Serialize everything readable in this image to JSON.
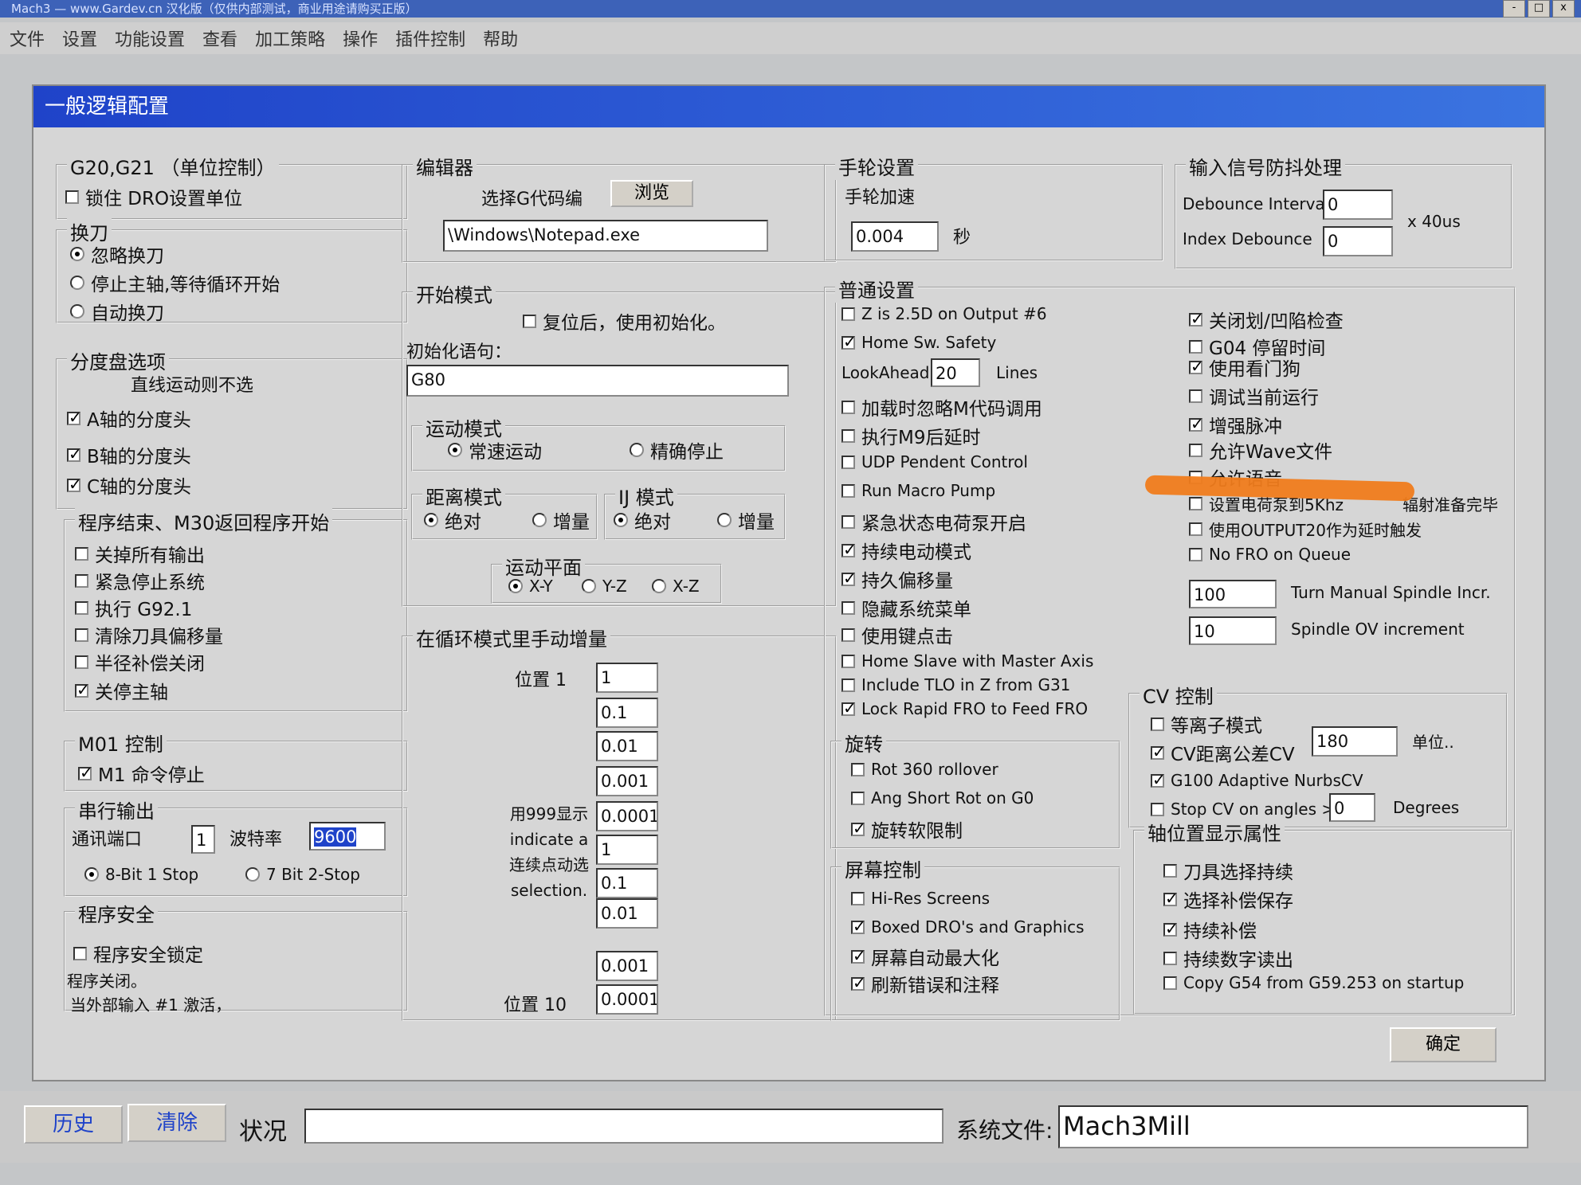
{
  "app": {
    "title": "Mach3 — www.Gardev.cn 汉化版（仅供内部测试，商业用途请购买正版）",
    "window_buttons": [
      "-",
      "□",
      "x"
    ],
    "menu": [
      "文件",
      "设置",
      "功能设置",
      "查看",
      "加工策略",
      "操作",
      "插件控制",
      "帮助"
    ]
  },
  "dialog": {
    "title": "一般逻辑配置",
    "units": {
      "legend": "G20,G21 （单位控制）",
      "lock_dro": {
        "label": "锁住 DRO设置单位",
        "checked": false
      }
    },
    "toolchange": {
      "legend": "换刀",
      "options": [
        {
          "label": "忽略换刀",
          "selected": true
        },
        {
          "label": "停止主轴,等待循环开始",
          "selected": false
        },
        {
          "label": "自动换刀",
          "selected": false
        }
      ]
    },
    "indexer": {
      "legend": "分度盘选项",
      "note": "直线运动则不选",
      "items": [
        {
          "label": "A轴的分度头",
          "checked": true
        },
        {
          "label": "B轴的分度头",
          "checked": true
        },
        {
          "label": "C轴的分度头",
          "checked": true
        }
      ]
    },
    "program_end": {
      "legend": "程序结束、M30返回程序开始",
      "items": [
        {
          "label": "关掉所有输出",
          "checked": false
        },
        {
          "label": "紧急停止系统",
          "checked": false
        },
        {
          "label": "执行 G92.1",
          "checked": false
        },
        {
          "label": "清除刀具偏移量",
          "checked": false
        },
        {
          "label": "半径补偿关闭",
          "checked": false
        },
        {
          "label": "关停主轴",
          "checked": true
        }
      ]
    },
    "m01": {
      "legend": "M01 控制",
      "item": {
        "label": "M1 命令停止",
        "checked": true
      }
    },
    "serial": {
      "legend": "串行输出",
      "port_label": "通讯端口",
      "port_value": "1",
      "baud_label": "波特率",
      "baud_value": "9600",
      "modes": [
        {
          "label": "8-Bit 1 Stop",
          "selected": true
        },
        {
          "label": "7 Bit 2-Stop",
          "selected": false
        }
      ]
    },
    "safety": {
      "legend": "程序安全",
      "item": {
        "label": "程序安全锁定",
        "checked": false
      },
      "note1": "程序关闭。",
      "note2": "当外部输入 #1 激活，"
    },
    "editor": {
      "legend": "编辑器",
      "select_label": "选择G代码编",
      "browse": "浏览",
      "path": "\\Windows\\Notepad.exe"
    },
    "start_mode": {
      "legend": "开始模式",
      "reset_init": {
        "label": "复位后，使用初始化。",
        "checked": false
      },
      "init_label": "初始化语句：",
      "init_value": "G80",
      "motion": {
        "legend": "运动模式",
        "options": [
          {
            "label": "常速运动",
            "selected": true
          },
          {
            "label": "精确停止",
            "selected": false
          }
        ]
      },
      "distance": {
        "legend": "距离模式",
        "options": [
          {
            "label": "绝对",
            "selected": true
          },
          {
            "label": "增量",
            "selected": false
          }
        ]
      },
      "ij": {
        "legend": "IJ 模式",
        "options": [
          {
            "label": "绝对",
            "selected": true
          },
          {
            "label": "增量",
            "selected": false
          }
        ]
      },
      "plane": {
        "legend": "运动平面",
        "options": [
          {
            "label": "X-Y",
            "selected": true
          },
          {
            "label": "Y-Z",
            "selected": false
          },
          {
            "label": "X-Z",
            "selected": false
          }
        ]
      }
    },
    "cycle_jog": {
      "legend": "在循环模式里手动增量",
      "pos1": "位置 1",
      "pos10": "位置 10",
      "note": [
        "用999显示",
        "indicate a",
        "连续点动选",
        "selection."
      ],
      "values": [
        "1",
        "0.1",
        "0.01",
        "0.001",
        "0.0001",
        "1",
        "0.1",
        "0.01",
        "0.001",
        "0.0001"
      ]
    },
    "mpg": {
      "legend": "手轮设置",
      "accel_label": "手轮加速",
      "accel_value": "0.004",
      "unit": "秒"
    },
    "debounce": {
      "legend": "输入信号防抖处理",
      "interval_label": "Debounce Interval",
      "interval_value": "0",
      "index_label": "Index Debounce",
      "index_value": "0",
      "unit": "x 40us"
    },
    "general": {
      "legend": "普通设置",
      "left_a": [
        {
          "label": "Z is 2.5D on Output #6",
          "checked": false
        },
        {
          "label": "Home Sw. Safety",
          "checked": true
        }
      ],
      "lookahead_label": "LookAhead",
      "lookahead_value": "20",
      "lookahead_unit": "Lines",
      "left_b": [
        {
          "label": "加载时忽略M代码调用",
          "checked": false
        },
        {
          "label": "执行M9后延时",
          "checked": false
        },
        {
          "label": "UDP Pendent Control",
          "checked": false
        },
        {
          "label": "Run Macro Pump",
          "checked": false
        },
        {
          "label": "紧急状态电荷泵开启",
          "checked": false
        },
        {
          "label": "持续电动模式",
          "checked": true
        },
        {
          "label": "持久偏移量",
          "checked": true
        },
        {
          "label": "隐藏系统菜单",
          "checked": false
        },
        {
          "label": "使用键点击",
          "checked": false
        },
        {
          "label": "Home Slave with Master Axis",
          "checked": false
        },
        {
          "label": "Include TLO in Z from G31",
          "checked": false
        },
        {
          "label": "Lock Rapid FRO to Feed FRO",
          "checked": true
        }
      ],
      "right": [
        {
          "label": "关闭划/凹陷检查",
          "checked": true
        },
        {
          "label": "G04 停留时间",
          "checked": false
        },
        {
          "label": "使用看门狗",
          "checked": true
        },
        {
          "label": "调试当前运行",
          "checked": false
        },
        {
          "label": "增强脉冲",
          "checked": true
        },
        {
          "label": "允许Wave文件",
          "checked": false
        },
        {
          "label": "允许语音",
          "checked": false
        },
        {
          "label": "设置电荷泵到5Khz",
          "checked": false
        },
        {
          "label": "使用OUTPUT20作为延时触发",
          "checked": false
        },
        {
          "label": "No FRO on Queue",
          "checked": false
        }
      ],
      "extra_note": "辐射准备完毕",
      "spindle_incr_value": "100",
      "spindle_incr_label": "Turn Manual Spindle Incr.",
      "spindle_ov_value": "10",
      "spindle_ov_label": "Spindle OV increment"
    },
    "rotation": {
      "legend": "旋转",
      "items": [
        {
          "label": "Rot 360 rollover",
          "checked": false
        },
        {
          "label": "Ang Short Rot on G0",
          "checked": false
        },
        {
          "label": "旋转软限制",
          "checked": true
        }
      ]
    },
    "screen": {
      "legend": "屏幕控制",
      "items": [
        {
          "label": "Hi-Res Screens",
          "checked": false
        },
        {
          "label": "Boxed DRO's and Graphics",
          "checked": true
        },
        {
          "label": "屏幕自动最大化",
          "checked": true
        },
        {
          "label": "刷新错误和注释",
          "checked": true
        }
      ]
    },
    "cv": {
      "legend": "CV 控制",
      "plasma": {
        "label": "等离子模式",
        "checked": false
      },
      "cv_dist": {
        "label": "CV距离公差CV",
        "checked": true
      },
      "cv_value": "180",
      "cv_unit": "单位..",
      "g100": {
        "label": "G100 Adaptive NurbsCV",
        "checked": true
      },
      "stop_angles": {
        "label": "Stop CV on angles >",
        "checked": false
      },
      "angle_value": "0",
      "angle_unit": "Degrees"
    },
    "axis_display": {
      "legend": "轴位置显示属性",
      "items": [
        {
          "label": "刀具选择持续",
          "checked": false
        },
        {
          "label": "选择补偿保存",
          "checked": true
        },
        {
          "label": "持续补偿",
          "checked": true
        },
        {
          "label": "持续数字读出",
          "checked": false
        },
        {
          "label": "Copy G54 from G59.253 on startup",
          "checked": false
        }
      ]
    },
    "ok": "确定"
  },
  "statusbar": {
    "history": "历史",
    "clear": "清除",
    "status_label": "状况",
    "status_value": "",
    "profile_label": "系统文件:",
    "profile_value": "Mach3Mill"
  },
  "colors": {
    "title_bar": "#1f43c9",
    "highlight": "#f07c1c",
    "face": "#d6d6d6"
  }
}
